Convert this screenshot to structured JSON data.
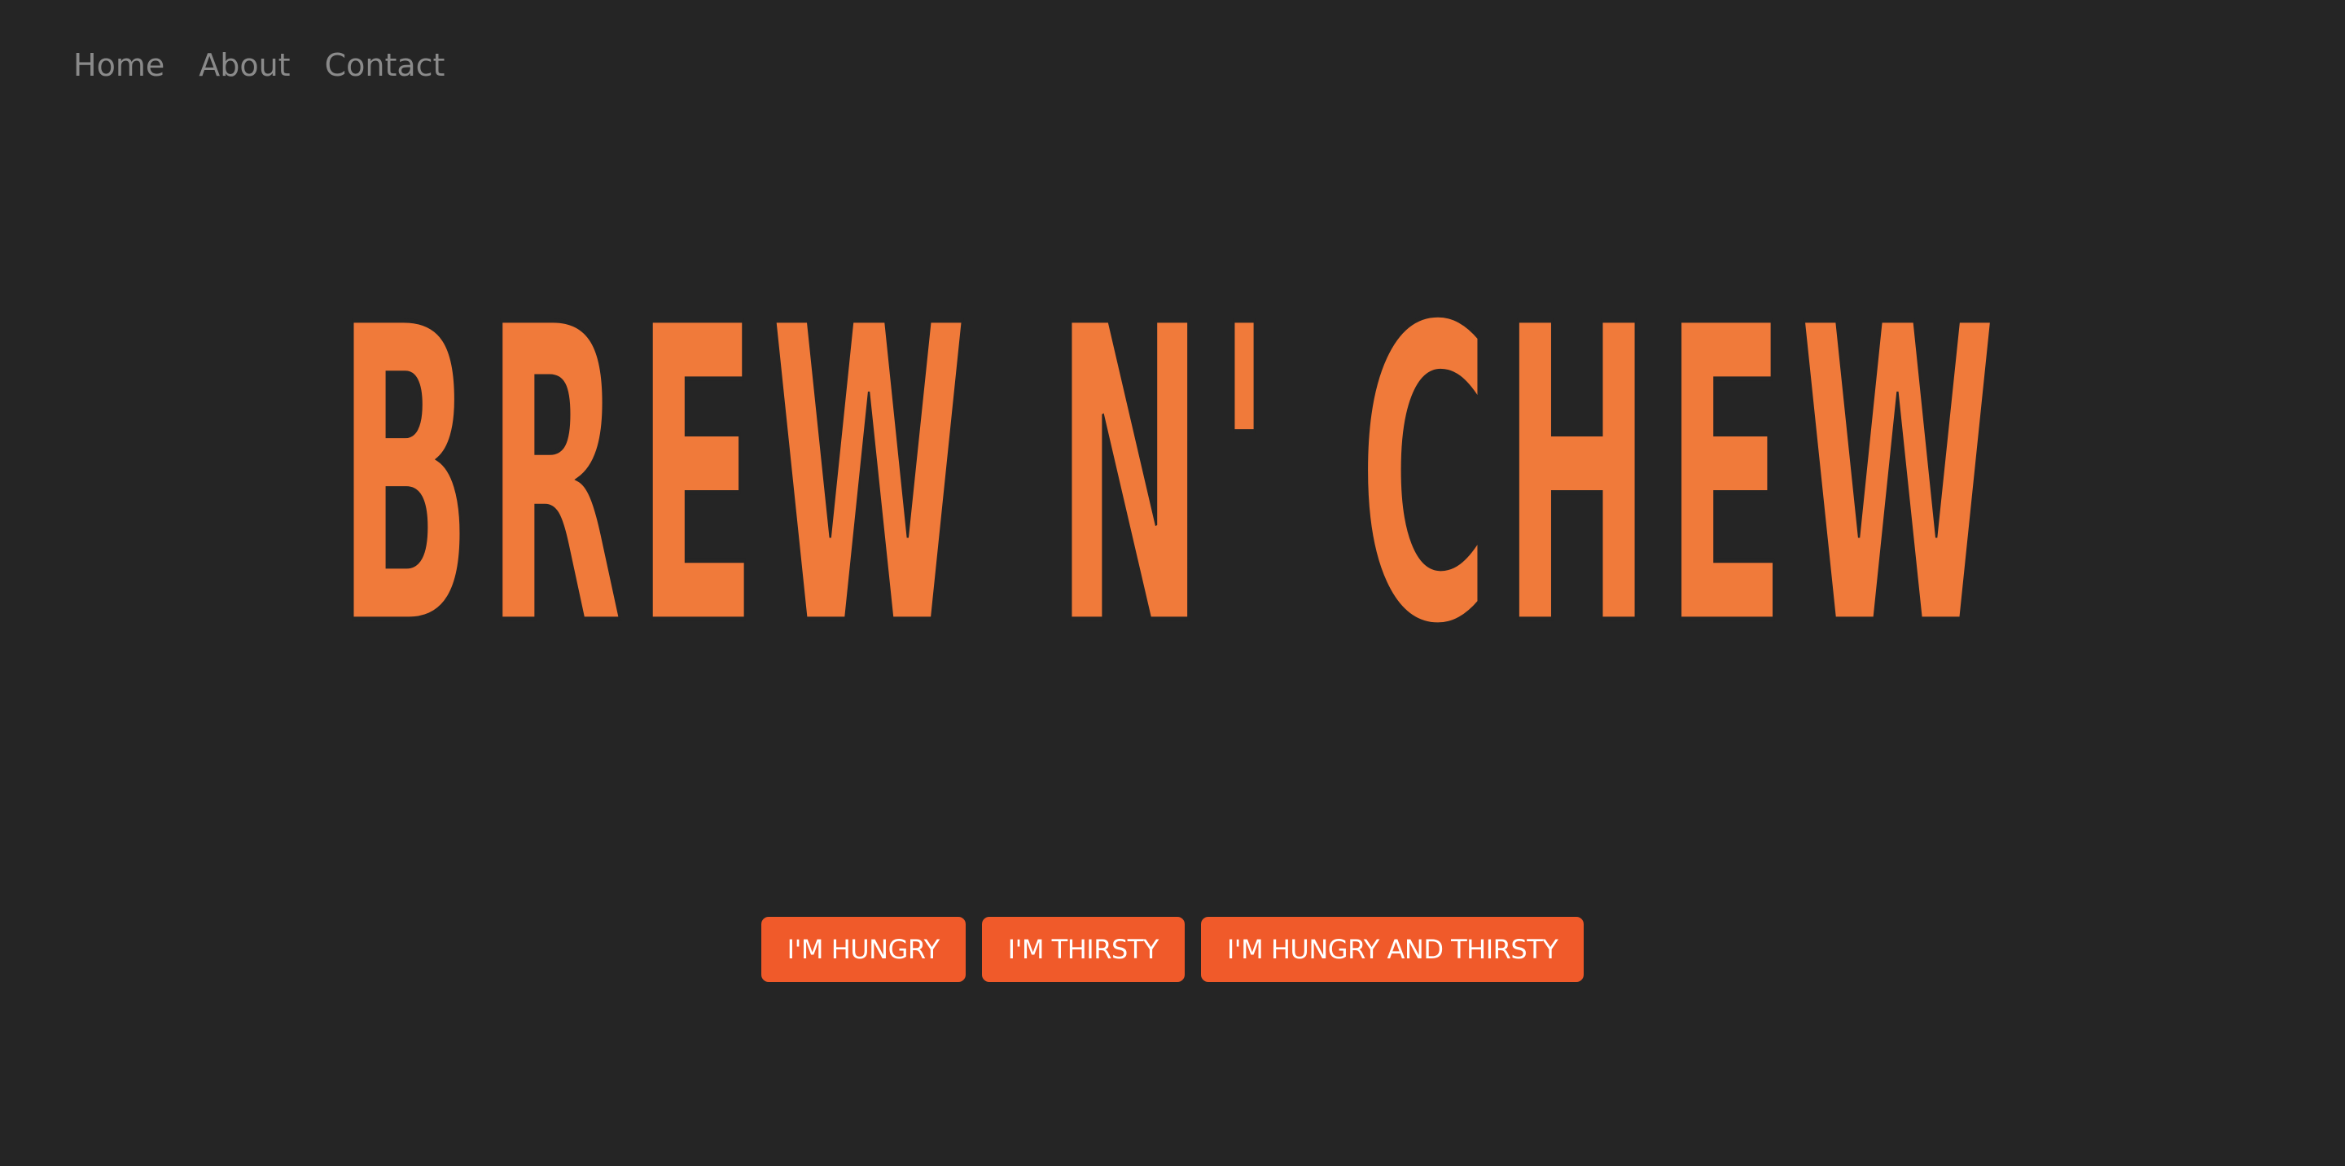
{
  "nav": {
    "items": [
      {
        "label": "Home"
      },
      {
        "label": "About"
      },
      {
        "label": "Contact"
      }
    ]
  },
  "hero": {
    "title": "BREW N' CHEW"
  },
  "actions": {
    "buttons": [
      {
        "label": "I'M HUNGRY"
      },
      {
        "label": "I'M THIRSTY"
      },
      {
        "label": "I'M HUNGRY AND THIRSTY"
      }
    ]
  },
  "colors": {
    "background": "#252525",
    "title": "#f07a3a",
    "button": "#f05a2a",
    "nav_text": "#8a8a8a",
    "inline": "#252525"
  }
}
